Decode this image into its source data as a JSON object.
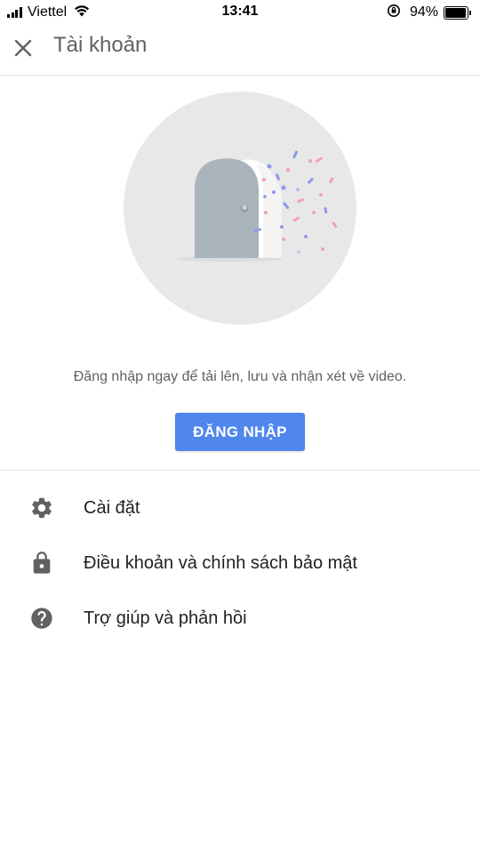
{
  "status_bar": {
    "carrier": "Viettel",
    "time": "13:41",
    "battery": "94%",
    "battery_level": 0.94
  },
  "app_bar": {
    "title": "Tài khoản",
    "close_icon": "close-icon"
  },
  "main": {
    "prompt": "Đăng nhập ngay để tải lên, lưu và nhận xét về video.",
    "signin_label": "ĐĂNG NHẬP",
    "accent_color": "#4f87ec"
  },
  "menu": {
    "items": [
      {
        "label": "Cài đặt",
        "icon": "gear-icon"
      },
      {
        "label": "Điều khoản và chính sách bảo mật",
        "icon": "lock-icon"
      },
      {
        "label": "Trợ giúp và phản hồi",
        "icon": "help-icon"
      }
    ]
  }
}
